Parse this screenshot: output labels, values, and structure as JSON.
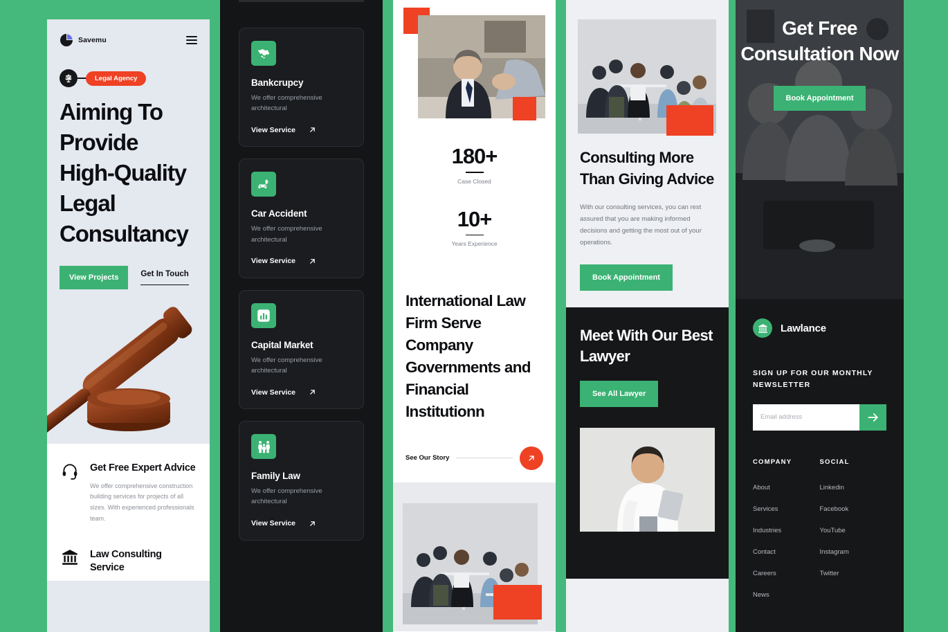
{
  "theme": {
    "green": "#3bb273",
    "bg_green": "#45b97c",
    "red": "#ef4123",
    "dark": "#161719",
    "light": "#e4e8ef"
  },
  "panel1": {
    "brand": "Savemu",
    "menu_icon": "hamburger-icon",
    "badge_icon": "scales-of-justice-icon",
    "badge": "Legal Agency",
    "headline": "Aiming To Provide High-Quality Legal Consultancy",
    "primary_cta": "View Projects",
    "secondary_cta": "Get In Touch",
    "hero_image_alt": "wooden-gavel-photo",
    "features": [
      {
        "icon": "headset-icon",
        "title": "Get Free Expert Advice",
        "body": "We offer comprehensive construction building services for projects of all sizes. With experienced professionals team."
      },
      {
        "icon": "bank-columns-icon",
        "title": "Law Consulting Service",
        "body": ""
      }
    ]
  },
  "panel2": {
    "cards": [
      {
        "icon": "handshake-icon",
        "title": "Bankcrupcy",
        "desc": "We offer comprehensive architectural",
        "link": "View Service"
      },
      {
        "icon": "car-crash-icon",
        "title": "Car Accident",
        "desc": "We offer comprehensive architectural",
        "link": "View Service"
      },
      {
        "icon": "bar-chart-icon",
        "title": "Capital Market",
        "desc": "We offer comprehensive architectural",
        "link": "View Service"
      },
      {
        "icon": "family-icon",
        "title": "Family Law",
        "desc": "We offer comprehensive architectural",
        "link": "View Service"
      }
    ]
  },
  "panel3": {
    "image_alt": "lawyer-meeting-photo",
    "stats": [
      {
        "value": "180+",
        "label": "Case Closed"
      },
      {
        "value": "10+",
        "label": "Years Experience"
      }
    ],
    "heading": "International Law Firm Serve Company Governments and Financial Institutionn",
    "story_label": "See Our Story",
    "story_icon": "arrow-up-right-icon",
    "bottom_image_alt": "team-around-table-photo"
  },
  "panel4": {
    "image_alt": "team-around-table-photo",
    "heading": "Consulting More Than Giving Advice",
    "paragraph": "With our consulting services, you can rest assured that you are making informed decisions and getting the most out of your operations.",
    "cta": "Book Appointment",
    "dark_heading": "Meet With Our Best Lawyer",
    "dark_cta": "See All Lawyer",
    "lawyer_image_alt": "smiling-lawyer-with-tablet-photo"
  },
  "panel5": {
    "hero_heading": "Get Free Consultation Now",
    "hero_cta": "Book Appointment",
    "hero_image_alt": "team-working-at-desk-photo",
    "brand": "Lawlance",
    "brand_icon": "bank-columns-icon",
    "newsletter_heading": "SIGN UP FOR OUR MONTHLY NEWSLETTER",
    "email_placeholder": "Email address",
    "email_value": "",
    "submit_icon": "arrow-right-icon",
    "columns": [
      {
        "title": "COMPANY",
        "links": [
          "About",
          "Services",
          "Industries",
          "Contact",
          "Careers",
          "News"
        ]
      },
      {
        "title": "SOCIAL",
        "links": [
          "Linkedin",
          "Facebook",
          "YouTube",
          "Instagram",
          "Twitter"
        ]
      }
    ]
  }
}
